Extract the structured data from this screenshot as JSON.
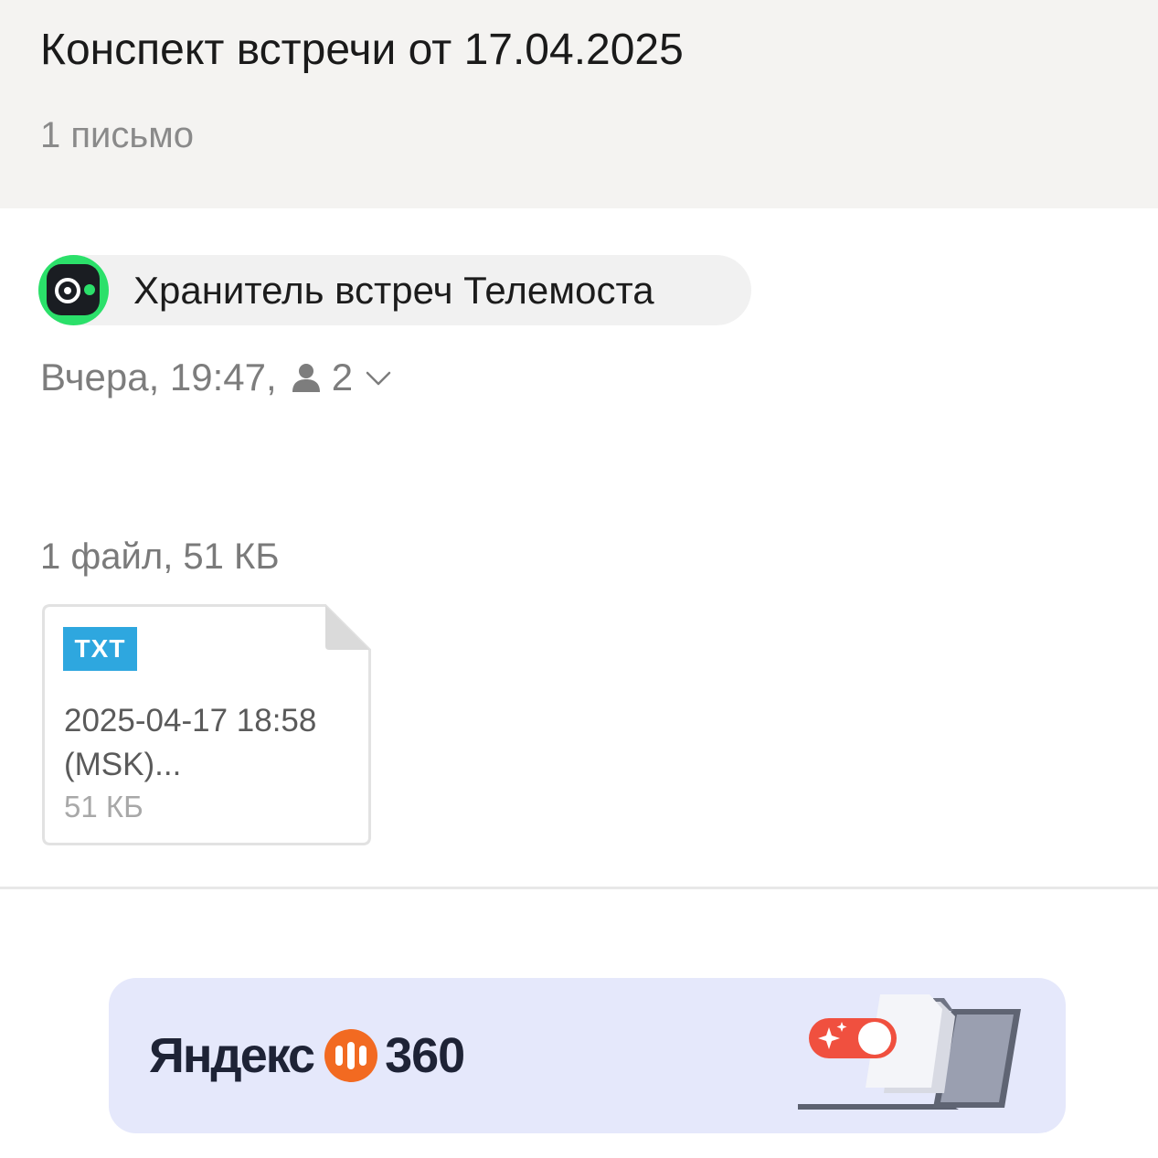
{
  "thread": {
    "title": "Конспект встречи от 17.04.2025",
    "message_count": "1 письмо"
  },
  "message": {
    "sender_name": "Хранитель встреч Телемоста",
    "date_text": "Вчера, 19:47,",
    "recipient_count": "2",
    "icons": {
      "avatar": "telemost-camera-icon",
      "recipients": "person-icon",
      "expand": "chevron-down-icon"
    }
  },
  "attachments": {
    "summary": "1 файл, 51 КБ",
    "files": [
      {
        "type_badge": "TXT",
        "name": "2025-04-17 18:58 (MSK)...",
        "size": "51 КБ"
      }
    ]
  },
  "promo": {
    "brand_name": "Яндекс",
    "brand_number": "360",
    "icons": {
      "logo": "yandex-360-logo-icon",
      "illustration": "laptop-toggle-illustration-icon"
    }
  },
  "colors": {
    "header_bg": "#f4f3f1",
    "avatar_green": "#2be06a",
    "badge_blue": "#2ea7df",
    "banner_bg": "#e5e8fb",
    "brand_orange": "#f26a21",
    "toggle_red": "#f0503f"
  }
}
